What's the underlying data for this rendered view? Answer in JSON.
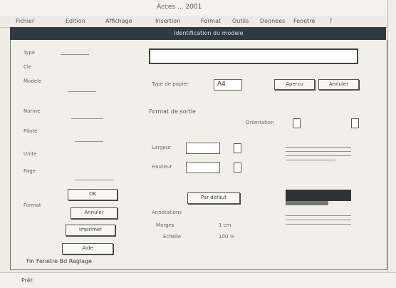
{
  "app": {
    "title": "Acces ... 2001",
    "window_title": "Identification du modele"
  },
  "menu": [
    "Fichier",
    "Edition",
    "Affichage",
    "Insertion",
    "Format",
    "Outils",
    "Donnees",
    "Fenetre",
    "?"
  ],
  "left_panel": {
    "items": [
      "Type",
      "Cle",
      "Modele",
      "",
      "Norme",
      "",
      "Pilote",
      "",
      "Unite",
      "",
      "Page",
      "Format"
    ],
    "buttons": [
      "OK",
      "Annuler",
      "Imprimer",
      "Aide"
    ]
  },
  "main": {
    "top_field_value": "",
    "row1_label": "Type de papier",
    "row1_value": "A4",
    "btn_apercu": "Apercu",
    "btn_annuler": "Annuler",
    "section": "Format de sortie",
    "width_label": "Largeur",
    "height_label": "Hauteur",
    "orientation_label": "Orientation",
    "unit": "cm",
    "default_button": "Par defaut",
    "footer_labels": [
      "Annotations",
      "Marges",
      "Echelle"
    ],
    "footer_values": [
      "1 cm",
      "100 %"
    ]
  },
  "status": {
    "left": "Fin Fenetre Bd Reglage",
    "bottom": "Prêt"
  }
}
